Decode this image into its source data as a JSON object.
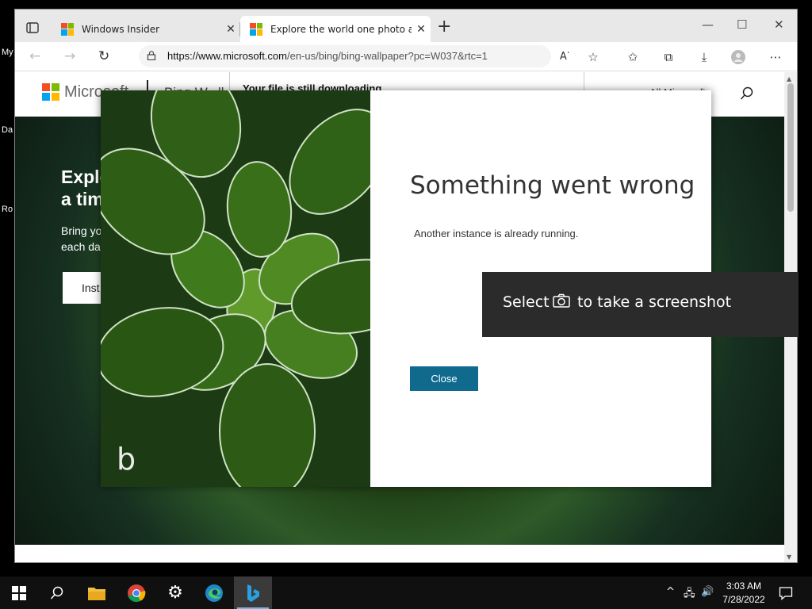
{
  "desktop": {
    "icon_labels": [
      "My",
      "Da",
      "Ro"
    ]
  },
  "browser": {
    "tabs": [
      {
        "title": "Windows Insider",
        "active": false
      },
      {
        "title": "Explore the world one photo at a",
        "active": true
      }
    ],
    "new_tab_label": "+",
    "window_controls": {
      "minimize": "—",
      "maximize": "☐",
      "close": "✕"
    },
    "address": {
      "host": "https://www.microsoft.com",
      "path": "/en-us/bing/bing-wallpaper?pc=W037&rtc=1"
    },
    "download_notice": "Your file is still downloading"
  },
  "page": {
    "brand": "Microsoft",
    "nav_fragment": "Bing W...ll",
    "nav_right_fragment": "All Microsoft",
    "hero_title_lines": [
      "Explo",
      "a tim"
    ],
    "hero_sub_lines": [
      "Bring yo",
      "each da"
    ],
    "hero_button": "Inst"
  },
  "dialog": {
    "title": "Something went wrong",
    "message": "Another instance is already running.",
    "close_button": "Close"
  },
  "toast": {
    "before": "Select",
    "icon": "camera-icon",
    "after": "to take a screenshot"
  },
  "taskbar": {
    "apps": [
      "start",
      "search",
      "file-explorer",
      "chrome",
      "settings",
      "edge",
      "bing-wallpaper"
    ],
    "active_app": "bing-wallpaper",
    "time": "3:03 AM",
    "date": "7/28/2022"
  },
  "colors": {
    "dialog_button": "#0f6a8e",
    "ms_red": "#f25022",
    "ms_green": "#7fba00",
    "ms_blue": "#00a4ef",
    "ms_yellow": "#ffb900"
  }
}
